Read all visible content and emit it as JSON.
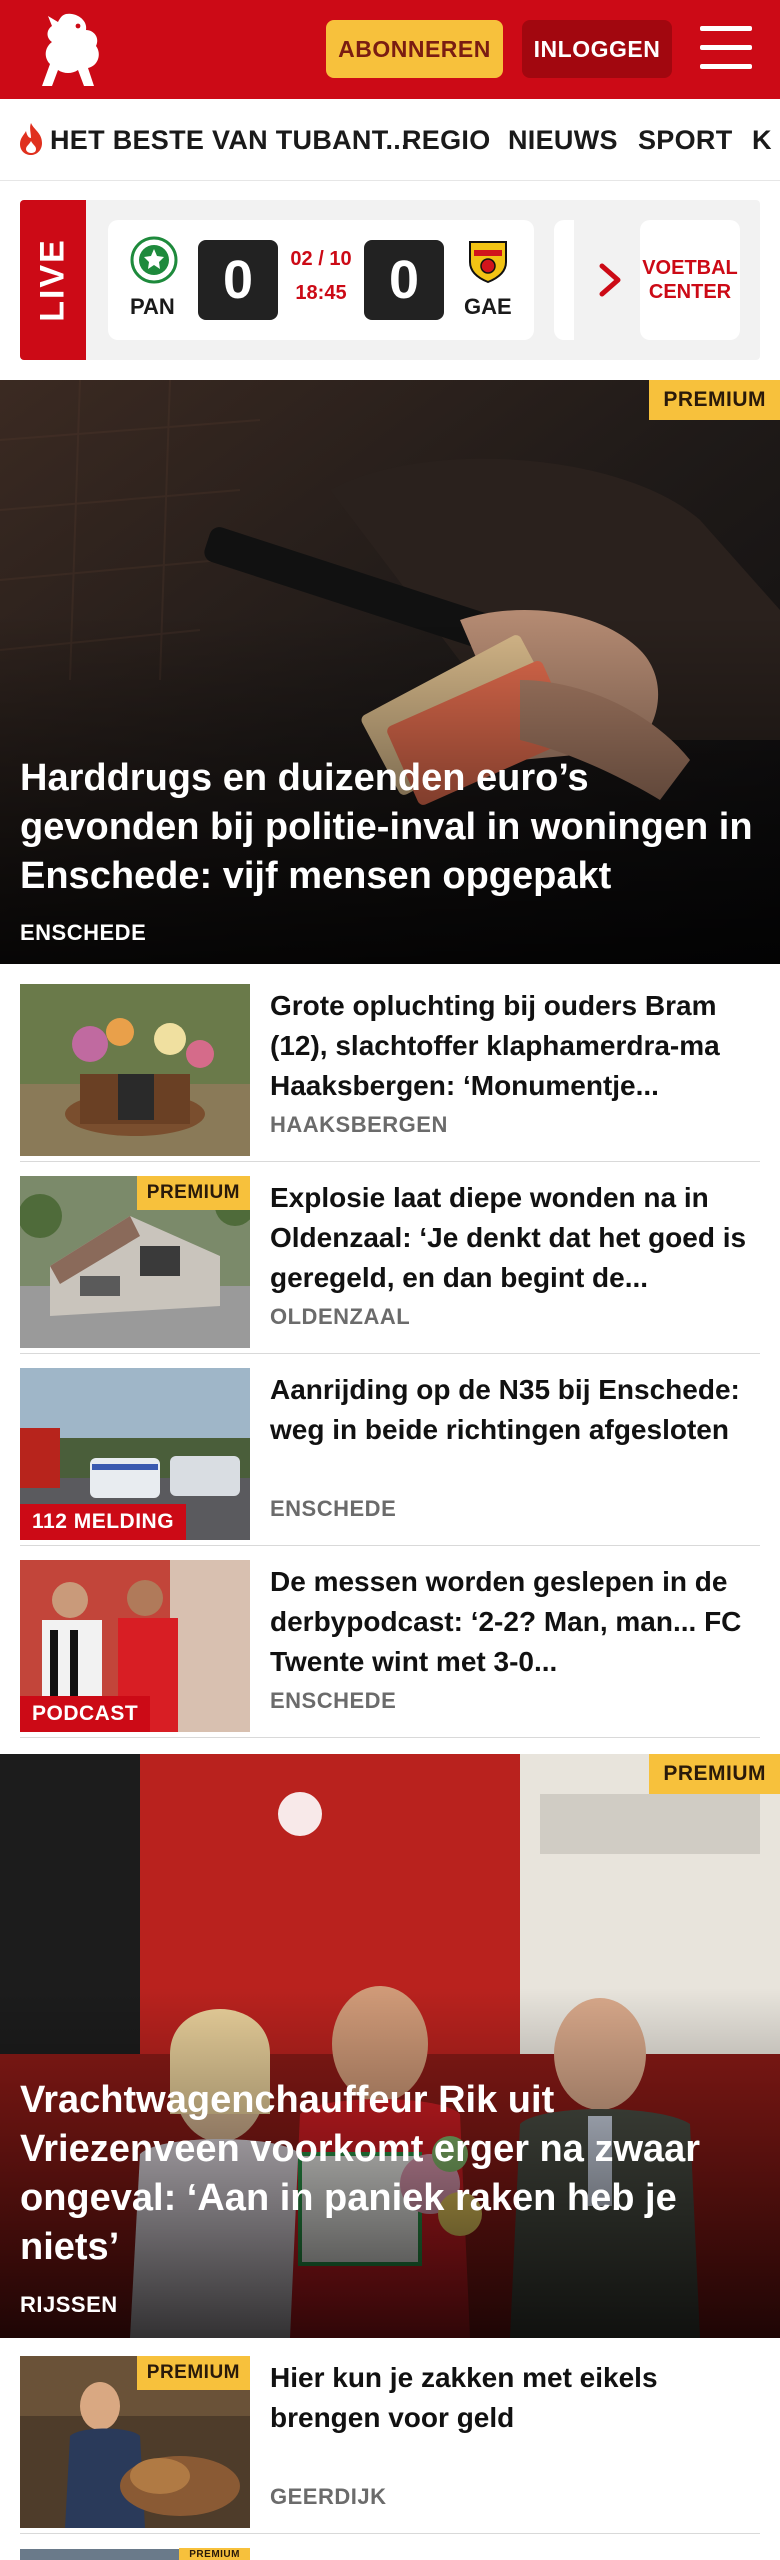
{
  "header": {
    "subscribe_label": "ABONNEREN",
    "login_label": "INLOGGEN",
    "brand_color": "#cc0a16"
  },
  "nav": {
    "items": [
      {
        "label": "HET BESTE VAN TUBANT..."
      },
      {
        "label": "REGIO"
      },
      {
        "label": "NIEUWS"
      },
      {
        "label": "SPORT"
      },
      {
        "label": "K"
      }
    ]
  },
  "live": {
    "tag": "LIVE",
    "match": {
      "home": "PAN",
      "away": "GAE",
      "home_score": "0",
      "away_score": "0",
      "date": "02 / 10",
      "time": "18:45"
    },
    "voetbal_center": "VOETBAL CENTER"
  },
  "articles": {
    "hero1": {
      "premium": "PREMIUM",
      "title": "Harddrugs en duizenden euro’s gevonden bij politie-inval in woningen in Enschede: vijf mensen opgepakt",
      "location": "ENSCHEDE"
    },
    "list1": [
      {
        "title": "Grote opluchting bij ouders Bram (12), slachtoffer klaphamerdra-ma Haaksbergen: ‘Monumentje...",
        "location": "HAAKSBERGEN",
        "premium": "",
        "label": ""
      },
      {
        "title": "Explosie laat diepe wonden na in Oldenzaal: ‘Je denkt dat het goed is geregeld, en dan begint de...",
        "location": "OLDENZAAL",
        "premium": "PREMIUM",
        "label": ""
      },
      {
        "title": "Aanrijding op de N35 bij Enschede: weg in beide richtingen afgesloten",
        "location": "ENSCHEDE",
        "premium": "",
        "label": "112 MELDING"
      },
      {
        "title": "De messen worden geslepen in de derbypodcast: ‘2-2? Man, man... FC Twente wint met 3-0...",
        "location": "ENSCHEDE",
        "premium": "",
        "label": "PODCAST"
      }
    ],
    "hero2": {
      "premium": "PREMIUM",
      "title": "Vrachtwagenchauffeur Rik uit Vriezenveen voorkomt erger na zwaar ongeval: ‘Aan in paniek raken heb je niets’",
      "location": "RIJSSEN"
    },
    "list2": [
      {
        "title": "Hier kun je zakken met eikels brengen voor geld",
        "location": "GEERDIJK",
        "premium": "PREMIUM",
        "label": ""
      }
    ],
    "next_partial": {
      "premium": "PREMIUM"
    }
  }
}
